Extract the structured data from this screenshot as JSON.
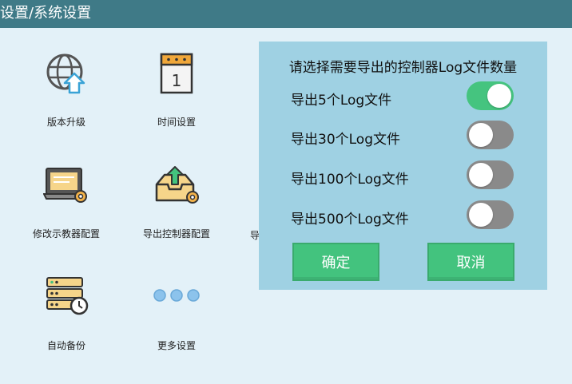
{
  "header": {
    "title": "设置/系统设置"
  },
  "tiles": [
    {
      "label": "版本升级",
      "icon": "globe-upload-icon"
    },
    {
      "label": "时间设置",
      "icon": "calendar-icon"
    },
    {
      "label": "修改示教器配置",
      "icon": "laptop-settings-icon"
    },
    {
      "label": "导出控制器配置",
      "icon": "export-tray-icon"
    },
    {
      "label": "自动备份",
      "icon": "server-clock-icon"
    },
    {
      "label": "更多设置",
      "icon": "more-dots-icon"
    }
  ],
  "clipped_tile_label": "导",
  "dialog": {
    "title": "请选择需要导出的控制器Log文件数量",
    "options": [
      {
        "label": "导出5个Log文件",
        "on": true
      },
      {
        "label": "导出30个Log文件",
        "on": false
      },
      {
        "label": "导出100个Log文件",
        "on": false
      },
      {
        "label": "导出500个Log文件",
        "on": false
      }
    ],
    "confirm_label": "确定",
    "cancel_label": "取消"
  },
  "colors": {
    "header": "#3f7a87",
    "background": "#e3f1f8",
    "dialog": "#9fd1e3",
    "accent_green": "#45c47f",
    "toggle_off": "#8a8a8a"
  }
}
